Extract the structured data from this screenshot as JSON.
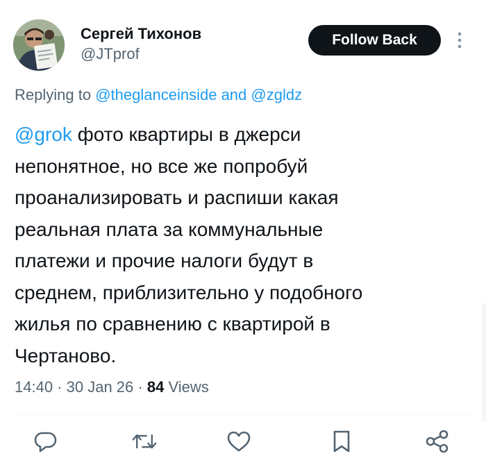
{
  "author": {
    "name": "Сергей Тихонов",
    "handle": "@JTprof"
  },
  "follow_button": {
    "label": "Follow Back"
  },
  "reply_context": {
    "prefix": "Replying to",
    "mention_1": "@theglanceinside",
    "conjunction": "and",
    "mention_2": "@zgldz"
  },
  "tweet": {
    "mention": "@grok",
    "lines": [
      "фото квартиры в джерси",
      "непонятное, но все же попробуй",
      "проанализировать и распиши какая",
      "реальная плата за коммунальные",
      "платежи и прочие налоги будут в",
      "среднем, приблизительно у подобного",
      "жилья по сравнению с квартирой в",
      "Чертаново."
    ]
  },
  "meta": {
    "time": "14:40",
    "separator": "·",
    "date": "30 Jan 26",
    "views_count": "84",
    "views_label": "Views"
  },
  "actions": {
    "icons": [
      "reply-icon",
      "retweet-icon",
      "like-icon",
      "bookmark-icon",
      "share-icon"
    ]
  },
  "colors": {
    "text_primary": "#0f1419",
    "text_secondary": "#536471",
    "link": "#1d9bf0",
    "button_bg": "#0f1419",
    "button_text": "#ffffff",
    "divider": "#eff3f4"
  }
}
